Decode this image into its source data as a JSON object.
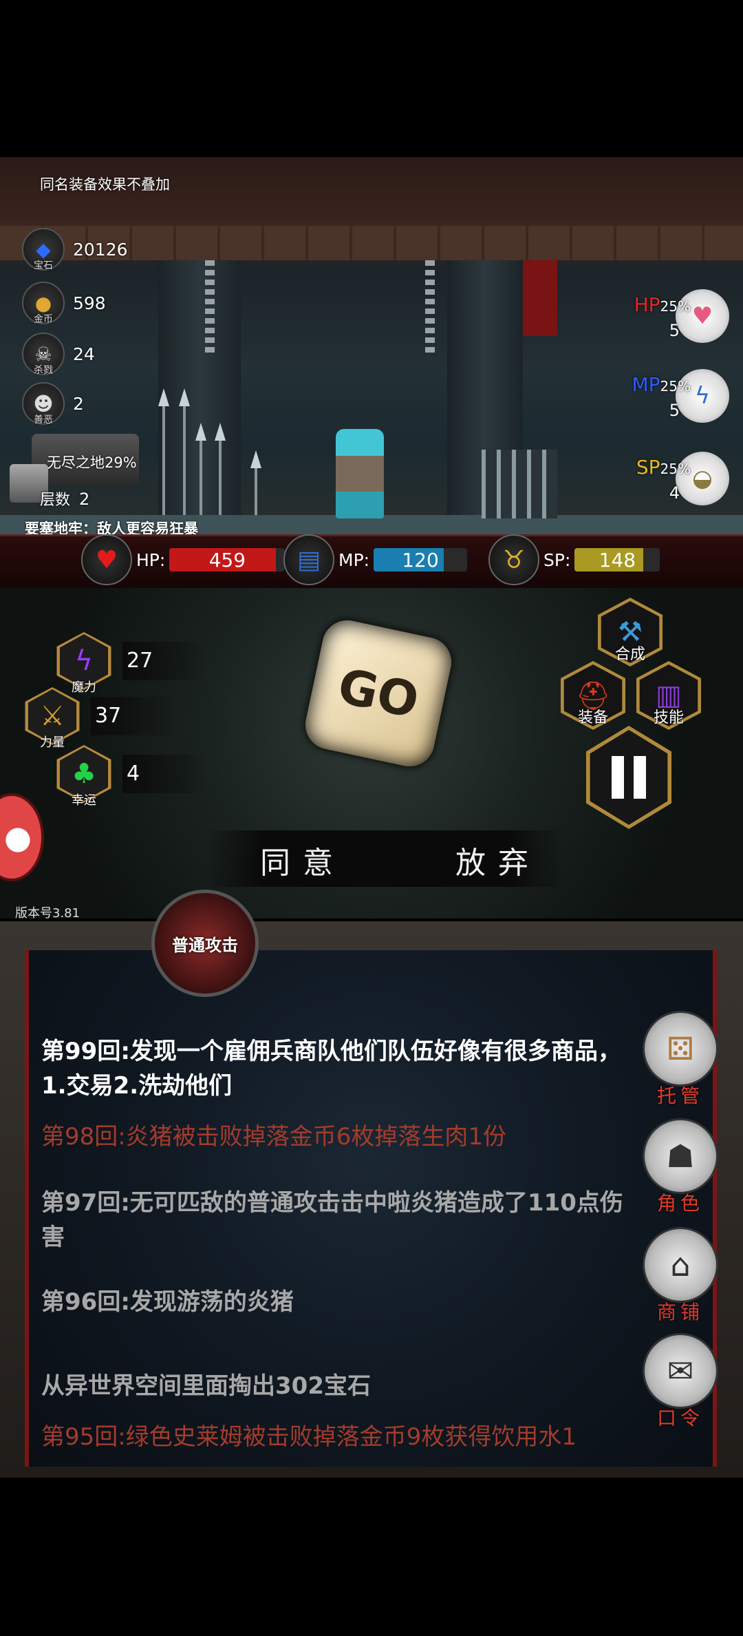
{
  "notice": "同名装备效果不叠加",
  "stats": {
    "gems": {
      "icon_label": "宝石",
      "value": "20126"
    },
    "gold": {
      "icon_label": "金币",
      "value": "598"
    },
    "kills": {
      "icon_label": "杀戮",
      "value": "24"
    },
    "evil": {
      "icon_label": "善恶",
      "value": "2"
    }
  },
  "location": {
    "name": "无尽之地29%",
    "floor_label": "层数",
    "floor_value": "2",
    "modifier": "要塞地牢：敌人更容易狂暴"
  },
  "potions": {
    "hp": {
      "label": "HP",
      "pct": "25%",
      "count": "5",
      "color": "#e32626"
    },
    "mp": {
      "label": "MP",
      "pct": "25%",
      "count": "5",
      "color": "#2a5bff"
    },
    "sp": {
      "label": "SP",
      "pct": "25%",
      "count": "4",
      "color": "#e6b81e"
    }
  },
  "resources": {
    "hp": {
      "label": "HP:",
      "value": "459",
      "fill": 0.92,
      "color": "#c21818"
    },
    "mp": {
      "label": "MP:",
      "value": "120",
      "fill": 0.75,
      "color": "#1a7fb0"
    },
    "sp": {
      "label": "SP:",
      "value": "148",
      "fill": 0.8,
      "color": "#a89a22"
    }
  },
  "attributes": {
    "magic": {
      "label": "魔力",
      "value": "27"
    },
    "strength": {
      "label": "力量",
      "value": "37"
    },
    "luck": {
      "label": "幸运",
      "value": "4"
    }
  },
  "dice_label": "GO",
  "menu": {
    "synthesize": "合成",
    "equipment": "装备",
    "skills": "技能"
  },
  "actions": {
    "agree": "同意",
    "abandon": "放弃"
  },
  "version": "版本号3.81",
  "attack_label": "普通攻击",
  "log": [
    {
      "text": "第99回:发现一个雇佣兵商队他们队伍好像有很多商品，1.交易2.洗劫他们",
      "style": "white"
    },
    {
      "text": "第98回:炎猪被击败掉落金币6枚掉落生肉1份",
      "style": "red"
    },
    {
      "text": "第97回:无可匹敌的普通攻击击中啦炎猪造成了110点伤害",
      "style": "grey"
    },
    {
      "text": "第96回:发现游荡的炎猪",
      "style": "grey"
    },
    {
      "text": "从异世界空间里面掏出302宝石",
      "style": "grey"
    },
    {
      "text": "第95回:绿色史莱姆被击败掉落金币9枚获得饮用水1",
      "style": "red"
    }
  ],
  "side_buttons": {
    "auto": "托管",
    "character": "角色",
    "shop": "商铺",
    "code": "口令"
  }
}
